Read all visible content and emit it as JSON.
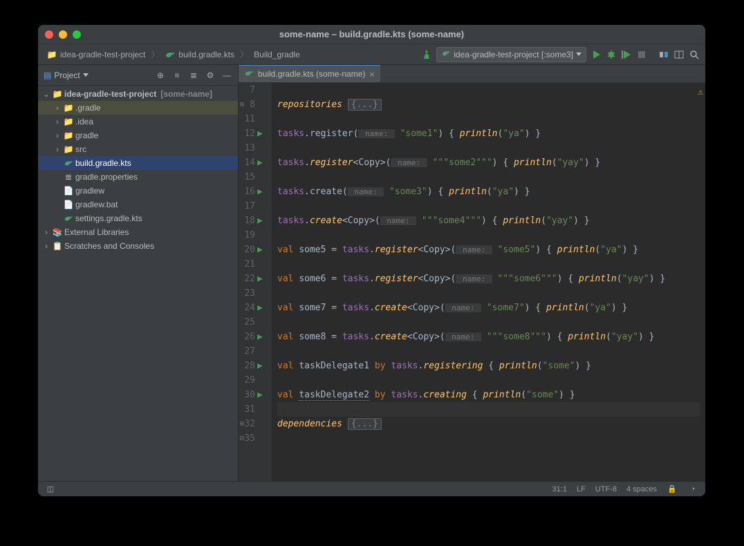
{
  "window": {
    "title": "some-name – build.gradle.kts (some-name)"
  },
  "breadcrumb": {
    "items": [
      "idea-gradle-test-project",
      "build.gradle.kts"
    ],
    "context": "Build_gradle"
  },
  "runConfig": {
    "label": "idea-gradle-test-project [:some3]"
  },
  "projectPanel": {
    "title": "Project",
    "tree": [
      {
        "label": "idea-gradle-test-project",
        "suffix": "[some-name]",
        "depth": 0,
        "arrow": "down",
        "icon": "folder",
        "iconColor": "folder-blue",
        "bold": true
      },
      {
        "label": ".gradle",
        "depth": 1,
        "arrow": "right",
        "icon": "folder",
        "iconColor": "folder-orange",
        "dim": true
      },
      {
        "label": ".idea",
        "depth": 1,
        "arrow": "right",
        "icon": "folder",
        "iconColor": "folder-blue"
      },
      {
        "label": "gradle",
        "depth": 1,
        "arrow": "right",
        "icon": "folder",
        "iconColor": "folder-blue"
      },
      {
        "label": "src",
        "depth": 1,
        "arrow": "right",
        "icon": "folder",
        "iconColor": "folder-blue"
      },
      {
        "label": "build.gradle.kts",
        "depth": 1,
        "arrow": "",
        "icon": "gradle",
        "selected": true
      },
      {
        "label": "gradle.properties",
        "depth": 1,
        "arrow": "",
        "icon": "props"
      },
      {
        "label": "gradlew",
        "depth": 1,
        "arrow": "",
        "icon": "file"
      },
      {
        "label": "gradlew.bat",
        "depth": 1,
        "arrow": "",
        "icon": "file"
      },
      {
        "label": "settings.gradle.kts",
        "depth": 1,
        "arrow": "",
        "icon": "gradle"
      },
      {
        "label": "External Libraries",
        "depth": 0,
        "arrow": "right",
        "icon": "lib"
      },
      {
        "label": "Scratches and Consoles",
        "depth": 0,
        "arrow": "right",
        "icon": "scratch"
      }
    ]
  },
  "editor": {
    "tab": {
      "label": "build.gradle.kts (some-name)"
    },
    "lines": [
      {
        "n": 7,
        "mark": "",
        "html": ""
      },
      {
        "n": 8,
        "mark": "",
        "fold": "⊞",
        "tokens": [
          {
            "t": "repositories ",
            "c": "fn"
          },
          {
            "t": "{...}",
            "c": "fold-box"
          }
        ]
      },
      {
        "n": 11,
        "mark": "",
        "html": ""
      },
      {
        "n": 12,
        "mark": "▶",
        "tokens": [
          {
            "t": "tasks",
            "c": "id"
          },
          {
            "t": ".",
            "c": "op"
          },
          {
            "t": "register",
            "c": "plain"
          },
          {
            "t": "(",
            "c": "op"
          },
          {
            "t": " name: ",
            "c": "hint"
          },
          {
            "t": " ",
            "c": ""
          },
          {
            "t": "\"some1\"",
            "c": "str"
          },
          {
            "t": ") { ",
            "c": "op"
          },
          {
            "t": "println",
            "c": "fn"
          },
          {
            "t": "(",
            "c": "op"
          },
          {
            "t": "\"ya\"",
            "c": "str"
          },
          {
            "t": ") }",
            "c": "op"
          }
        ]
      },
      {
        "n": 13,
        "mark": "",
        "html": ""
      },
      {
        "n": 14,
        "mark": "▶",
        "tokens": [
          {
            "t": "tasks",
            "c": "id"
          },
          {
            "t": ".",
            "c": "op"
          },
          {
            "t": "register",
            "c": "fn"
          },
          {
            "t": "<Copy>(",
            "c": "op"
          },
          {
            "t": " name: ",
            "c": "hint"
          },
          {
            "t": " ",
            "c": ""
          },
          {
            "t": "\"\"\"some2\"\"\"",
            "c": "str"
          },
          {
            "t": ") { ",
            "c": "op"
          },
          {
            "t": "println",
            "c": "fn"
          },
          {
            "t": "(",
            "c": "op"
          },
          {
            "t": "\"yay\"",
            "c": "str"
          },
          {
            "t": ") }",
            "c": "op"
          }
        ]
      },
      {
        "n": 15,
        "mark": "",
        "html": ""
      },
      {
        "n": 16,
        "mark": "▶",
        "tokens": [
          {
            "t": "tasks",
            "c": "id"
          },
          {
            "t": ".",
            "c": "op"
          },
          {
            "t": "create",
            "c": "plain"
          },
          {
            "t": "(",
            "c": "op"
          },
          {
            "t": " name: ",
            "c": "hint"
          },
          {
            "t": " ",
            "c": ""
          },
          {
            "t": "\"some3\"",
            "c": "str"
          },
          {
            "t": ") { ",
            "c": "op"
          },
          {
            "t": "println",
            "c": "fn"
          },
          {
            "t": "(",
            "c": "op"
          },
          {
            "t": "\"ya\"",
            "c": "str"
          },
          {
            "t": ") }",
            "c": "op"
          }
        ]
      },
      {
        "n": 17,
        "mark": "",
        "html": ""
      },
      {
        "n": 18,
        "mark": "▶",
        "tokens": [
          {
            "t": "tasks",
            "c": "id"
          },
          {
            "t": ".",
            "c": "op"
          },
          {
            "t": "create",
            "c": "fn"
          },
          {
            "t": "<Copy>(",
            "c": "op"
          },
          {
            "t": " name: ",
            "c": "hint"
          },
          {
            "t": " ",
            "c": ""
          },
          {
            "t": "\"\"\"some4\"\"\"",
            "c": "str"
          },
          {
            "t": ") { ",
            "c": "op"
          },
          {
            "t": "println",
            "c": "fn"
          },
          {
            "t": "(",
            "c": "op"
          },
          {
            "t": "\"yay\"",
            "c": "str"
          },
          {
            "t": ") }",
            "c": "op"
          }
        ]
      },
      {
        "n": 19,
        "mark": "",
        "html": ""
      },
      {
        "n": 20,
        "mark": "▶",
        "tokens": [
          {
            "t": "val ",
            "c": "kw"
          },
          {
            "t": "some5 = ",
            "c": "plain"
          },
          {
            "t": "tasks",
            "c": "id"
          },
          {
            "t": ".",
            "c": "op"
          },
          {
            "t": "register",
            "c": "fn"
          },
          {
            "t": "<Copy>(",
            "c": "op"
          },
          {
            "t": " name: ",
            "c": "hint"
          },
          {
            "t": " ",
            "c": ""
          },
          {
            "t": "\"some5\"",
            "c": "str"
          },
          {
            "t": ") { ",
            "c": "op"
          },
          {
            "t": "println",
            "c": "fn"
          },
          {
            "t": "(",
            "c": "op"
          },
          {
            "t": "\"ya\"",
            "c": "str"
          },
          {
            "t": ") }",
            "c": "op"
          }
        ]
      },
      {
        "n": 21,
        "mark": "",
        "html": ""
      },
      {
        "n": 22,
        "mark": "▶",
        "tokens": [
          {
            "t": "val ",
            "c": "kw"
          },
          {
            "t": "some6 = ",
            "c": "plain"
          },
          {
            "t": "tasks",
            "c": "id"
          },
          {
            "t": ".",
            "c": "op"
          },
          {
            "t": "register",
            "c": "fn"
          },
          {
            "t": "<Copy>(",
            "c": "op"
          },
          {
            "t": " name: ",
            "c": "hint"
          },
          {
            "t": " ",
            "c": ""
          },
          {
            "t": "\"\"\"some6\"\"\"",
            "c": "str"
          },
          {
            "t": ") { ",
            "c": "op"
          },
          {
            "t": "println",
            "c": "fn"
          },
          {
            "t": "(",
            "c": "op"
          },
          {
            "t": "\"yay\"",
            "c": "str"
          },
          {
            "t": ") }",
            "c": "op"
          }
        ]
      },
      {
        "n": 23,
        "mark": "",
        "html": ""
      },
      {
        "n": 24,
        "mark": "▶",
        "tokens": [
          {
            "t": "val ",
            "c": "kw"
          },
          {
            "t": "some7 = ",
            "c": "plain"
          },
          {
            "t": "tasks",
            "c": "id"
          },
          {
            "t": ".",
            "c": "op"
          },
          {
            "t": "create",
            "c": "fn"
          },
          {
            "t": "<Copy>(",
            "c": "op"
          },
          {
            "t": " name: ",
            "c": "hint"
          },
          {
            "t": " ",
            "c": ""
          },
          {
            "t": "\"some7\"",
            "c": "str"
          },
          {
            "t": ") { ",
            "c": "op"
          },
          {
            "t": "println",
            "c": "fn"
          },
          {
            "t": "(",
            "c": "op"
          },
          {
            "t": "\"ya\"",
            "c": "str"
          },
          {
            "t": ") }",
            "c": "op"
          }
        ]
      },
      {
        "n": 25,
        "mark": "",
        "html": ""
      },
      {
        "n": 26,
        "mark": "▶",
        "tokens": [
          {
            "t": "val ",
            "c": "kw"
          },
          {
            "t": "some8 = ",
            "c": "plain"
          },
          {
            "t": "tasks",
            "c": "id"
          },
          {
            "t": ".",
            "c": "op"
          },
          {
            "t": "create",
            "c": "fn"
          },
          {
            "t": "<Copy>(",
            "c": "op"
          },
          {
            "t": " name: ",
            "c": "hint"
          },
          {
            "t": " ",
            "c": ""
          },
          {
            "t": "\"\"\"some8\"\"\"",
            "c": "str"
          },
          {
            "t": ") { ",
            "c": "op"
          },
          {
            "t": "println",
            "c": "fn"
          },
          {
            "t": "(",
            "c": "op"
          },
          {
            "t": "\"yay\"",
            "c": "str"
          },
          {
            "t": ") }",
            "c": "op"
          }
        ]
      },
      {
        "n": 27,
        "mark": "",
        "html": ""
      },
      {
        "n": 28,
        "mark": "▶",
        "tokens": [
          {
            "t": "val ",
            "c": "kw"
          },
          {
            "t": "taskDelegate1 ",
            "c": "plain"
          },
          {
            "t": "by ",
            "c": "kw"
          },
          {
            "t": "tasks",
            "c": "id"
          },
          {
            "t": ".",
            "c": "op"
          },
          {
            "t": "registering",
            "c": "fn"
          },
          {
            "t": " { ",
            "c": "op"
          },
          {
            "t": "println",
            "c": "fn"
          },
          {
            "t": "(",
            "c": "op"
          },
          {
            "t": "\"some\"",
            "c": "str"
          },
          {
            "t": ") }",
            "c": "op"
          }
        ]
      },
      {
        "n": 29,
        "mark": "",
        "html": ""
      },
      {
        "n": 30,
        "mark": "▶",
        "tokens": [
          {
            "t": "val ",
            "c": "kw"
          },
          {
            "t": "taskDelegate2",
            "c": "plain underline-warn"
          },
          {
            "t": " ",
            "c": ""
          },
          {
            "t": "by ",
            "c": "kw"
          },
          {
            "t": "tasks",
            "c": "id"
          },
          {
            "t": ".",
            "c": "op"
          },
          {
            "t": "creating",
            "c": "fn"
          },
          {
            "t": " { ",
            "c": "op"
          },
          {
            "t": "println",
            "c": "fn"
          },
          {
            "t": "(",
            "c": "op"
          },
          {
            "t": "\"some\"",
            "c": "str"
          },
          {
            "t": ") }",
            "c": "op"
          }
        ]
      },
      {
        "n": 31,
        "mark": "",
        "html": "",
        "sel": true
      },
      {
        "n": 32,
        "mark": "",
        "fold": "⊞",
        "tokens": [
          {
            "t": "dependencies ",
            "c": "fn"
          },
          {
            "t": "{...}",
            "c": "fold-box"
          }
        ]
      },
      {
        "n": 35,
        "mark": "",
        "fold": "⊟",
        "html": ""
      }
    ]
  },
  "status": {
    "pos": "31:1",
    "lf": "LF",
    "enc": "UTF-8",
    "indent": "4 spaces"
  }
}
